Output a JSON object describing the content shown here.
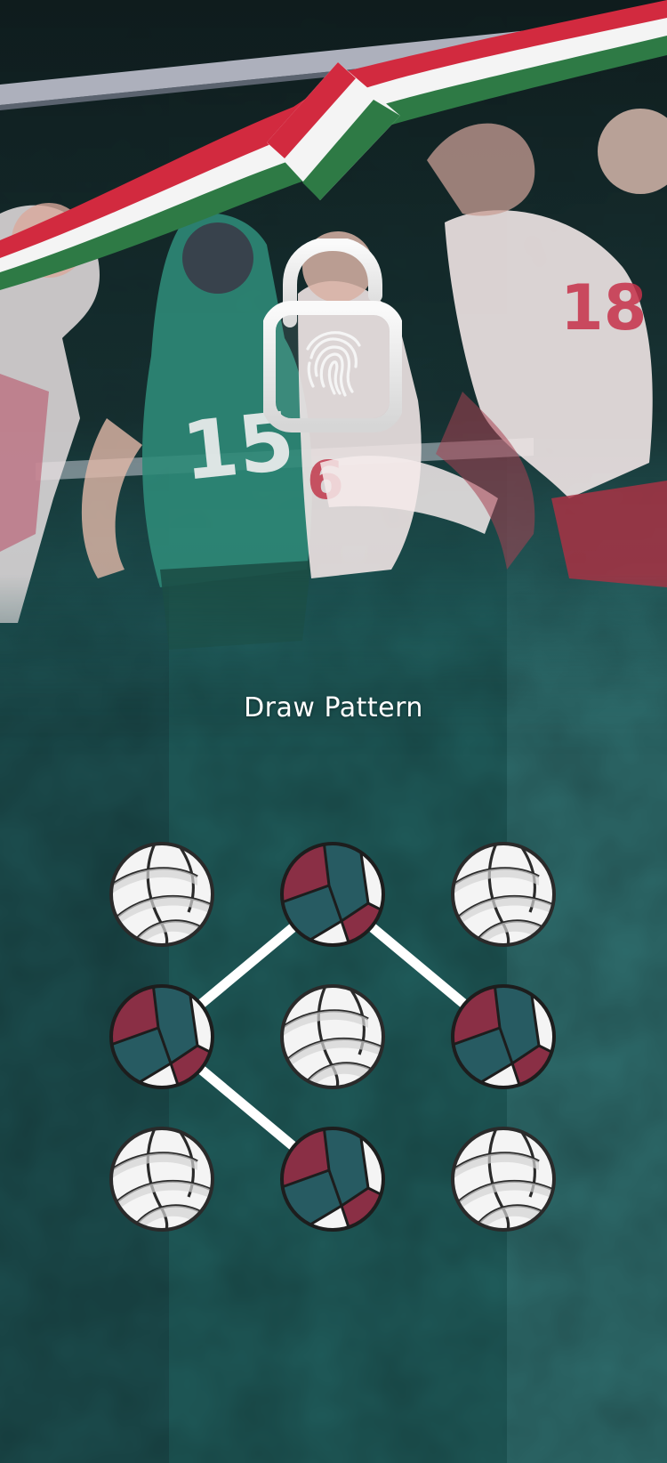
{
  "lock_screen": {
    "title": "Draw Pattern"
  },
  "icons": {
    "unlock": "fingerprint-padlock-icon",
    "ribbon": "flag-ribbon",
    "node": "volleyball-icon"
  },
  "colors": {
    "teal_dark": "#1d4f50",
    "teal_mid": "#205d5c",
    "teal_light": "#2f6e6e",
    "ribbon_red": "#d22a3f",
    "ribbon_white": "#f4f4f4",
    "ribbon_green": "#2e7a45",
    "ball_maroon": "#8a2f45",
    "ball_teal": "#275b62",
    "line": "#ffffff"
  },
  "pattern": {
    "nodes": [
      {
        "id": 1,
        "selected": false
      },
      {
        "id": 2,
        "selected": true
      },
      {
        "id": 3,
        "selected": false
      },
      {
        "id": 4,
        "selected": true
      },
      {
        "id": 5,
        "selected": false
      },
      {
        "id": 6,
        "selected": true
      },
      {
        "id": 7,
        "selected": false
      },
      {
        "id": 8,
        "selected": true
      },
      {
        "id": 9,
        "selected": false
      }
    ],
    "path": [
      6,
      2,
      4,
      8
    ]
  }
}
